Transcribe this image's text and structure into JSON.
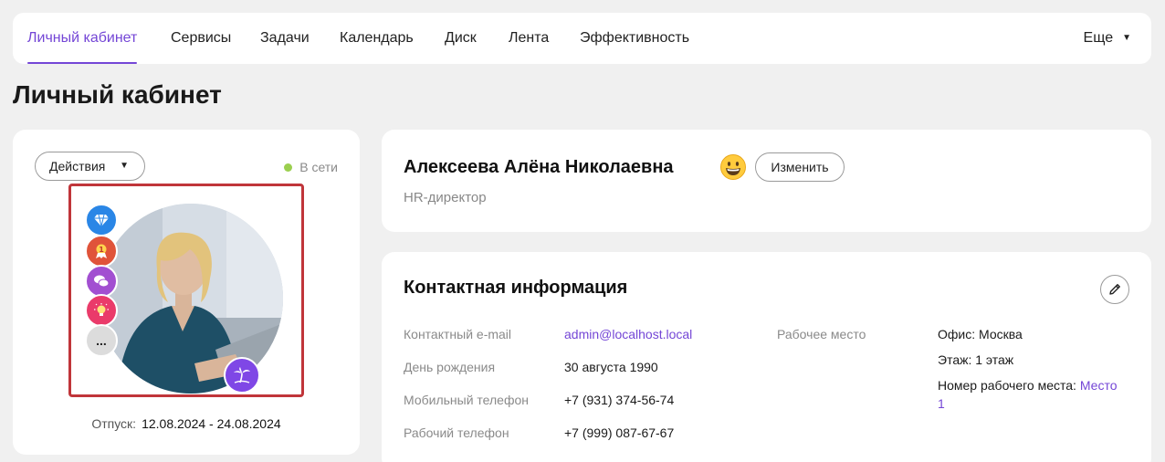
{
  "nav": {
    "items": [
      "Личный кабинет",
      "Сервисы",
      "Задачи",
      "Календарь",
      "Диск",
      "Лента",
      "Эффективность"
    ],
    "more_label": "Еще",
    "accent_color": "#7446d6"
  },
  "page_title": "Личный кабинет",
  "profile": {
    "actions_label": "Действия",
    "status": "В сети",
    "status_color": "#9bcf4f",
    "badges": [
      "diamond-icon",
      "medal-icon",
      "chat-icon",
      "lightbulb-icon",
      "more-icon"
    ],
    "more_badge_label": "...",
    "vacation_badge": "palm-tree-icon",
    "vacation_label": "Отпуск:",
    "vacation_dates": "12.08.2024 - 24.08.2024"
  },
  "header": {
    "name": "Алексеева Алёна Николаевна",
    "emoji": "grinning-face-icon",
    "edit_label": "Изменить",
    "position": "HR-директор"
  },
  "contact": {
    "title": "Контактная информация",
    "fields": [
      {
        "label": "Контактный e-mail",
        "value": "admin@localhost.local"
      },
      {
        "label": "День рождения",
        "value": "30 августа 1990"
      },
      {
        "label": "Мобильный телефон",
        "value": "+7 (931) 374-56-74"
      },
      {
        "label": "Рабочий телефон",
        "value": "+7 (999) 087-67-67"
      }
    ],
    "workplace": {
      "label": "Рабочее место",
      "office": "Офис: Москва",
      "floor": "Этаж: 1 этаж",
      "desk_label": "Номер рабочего места:",
      "desk_link_1": "Место",
      "desk_link_2": "1"
    }
  }
}
